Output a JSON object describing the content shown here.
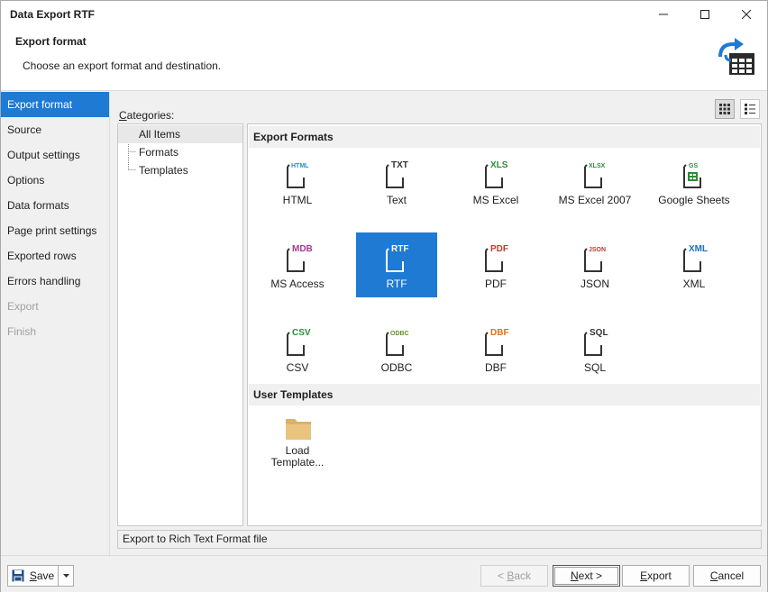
{
  "window": {
    "title": "Data Export RTF",
    "controls": {
      "minimize_icon": "minimize-icon",
      "maximize_icon": "maximize-icon",
      "close_icon": "close-icon"
    }
  },
  "header": {
    "title": "Export format",
    "description": "Choose an export format and destination.",
    "icon": "export-table-icon"
  },
  "nav": {
    "items": [
      {
        "label": "Export format",
        "state": "active"
      },
      {
        "label": "Source",
        "state": "normal"
      },
      {
        "label": "Output settings",
        "state": "normal"
      },
      {
        "label": "Options",
        "state": "normal"
      },
      {
        "label": "Data formats",
        "state": "normal"
      },
      {
        "label": "Page print settings",
        "state": "normal"
      },
      {
        "label": "Exported rows",
        "state": "normal"
      },
      {
        "label": "Errors handling",
        "state": "normal"
      },
      {
        "label": "Export",
        "state": "disabled"
      },
      {
        "label": "Finish",
        "state": "disabled"
      }
    ]
  },
  "main": {
    "categories_label": "Categories:",
    "view_buttons": {
      "tiles_icon": "tile-view-icon",
      "list_icon": "list-view-icon"
    },
    "categories": [
      {
        "label": "All Items",
        "selected": true
      },
      {
        "label": "Formats",
        "selected": false
      },
      {
        "label": "Templates",
        "selected": false
      }
    ],
    "export_formats_header": "Export Formats",
    "formats": [
      {
        "label": "HTML",
        "badge": "HTML",
        "color": "#1a8fd6"
      },
      {
        "label": "Text",
        "badge": "TXT",
        "color": "#333333"
      },
      {
        "label": "MS Excel",
        "badge": "XLS",
        "color": "#2e8b3a"
      },
      {
        "label": "MS Excel 2007",
        "badge": "XLSX",
        "color": "#2e8b3a"
      },
      {
        "label": "Google Sheets",
        "badge": "GS",
        "color": "#2e8b3a"
      },
      {
        "label": "MS Access",
        "badge": "MDB",
        "color": "#a33b8f"
      },
      {
        "label": "RTF",
        "badge": "RTF",
        "color": "#9b3f9b",
        "selected": true
      },
      {
        "label": "PDF",
        "badge": "PDF",
        "color": "#c0392b"
      },
      {
        "label": "JSON",
        "badge": "JSON",
        "color": "#c0392b"
      },
      {
        "label": "XML",
        "badge": "XML",
        "color": "#1a6fc6"
      },
      {
        "label": "CSV",
        "badge": "CSV",
        "color": "#2e8b3a"
      },
      {
        "label": "ODBC",
        "badge": "ODBC",
        "color": "#6a8e2b"
      },
      {
        "label": "DBF",
        "badge": "DBF",
        "color": "#e07020"
      },
      {
        "label": "SQL",
        "badge": "SQL",
        "color": "#333333"
      }
    ],
    "user_templates_header": "User Templates",
    "templates": [
      {
        "label_line1": "Load",
        "label_line2": "Template...",
        "icon": "folder-icon",
        "color": "#dcb26a"
      }
    ],
    "status_text": "Export to Rich Text Format file"
  },
  "footer": {
    "save_label": "Save",
    "save_icon": "floppy-disk-icon",
    "back_label": "< Back",
    "next_label": "Next >",
    "export_label": "Export",
    "cancel_label": "Cancel"
  },
  "colors": {
    "accent": "#1e7ad3",
    "group_header_bg": "#f0f0f0"
  }
}
